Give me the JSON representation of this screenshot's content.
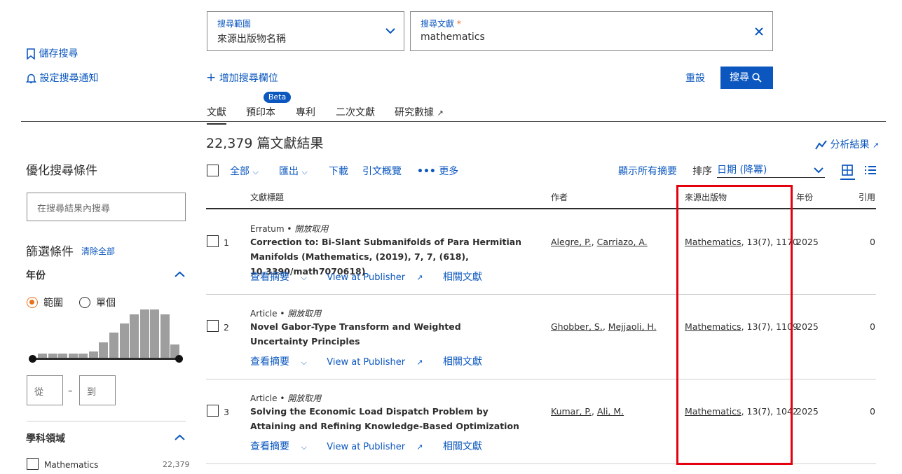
{
  "search": {
    "scope_label": "搜尋範圍",
    "scope_value": "來源出版物名稱",
    "query_label": "搜尋文獻",
    "query_required": "*",
    "query_value": "mathematics",
    "add_field": "增加搜尋欄位",
    "reset": "重設",
    "search_button": "搜尋"
  },
  "left_actions": {
    "save_search": "儲存搜尋",
    "set_alert": "設定搜尋通知"
  },
  "tabs": [
    {
      "label": "文獻",
      "active": true
    },
    {
      "label": "預印本",
      "badge": "Beta"
    },
    {
      "label": "專利"
    },
    {
      "label": "二次文獻"
    },
    {
      "label": "研究數據",
      "external": "↗"
    }
  ],
  "results": {
    "count_text": "22,379 篇文獻結果",
    "analyze": "分析結果",
    "toolbar": {
      "all": "全部",
      "export": "匯出",
      "download": "下載",
      "citation_overview": "引文概覽",
      "more": "更多",
      "show_abstracts": "顯示所有摘要",
      "sort_label": "排序",
      "sort_value": "日期 (降冪)"
    },
    "columns": {
      "title": "文獻標題",
      "authors": "作者",
      "source": "來源出版物",
      "year": "年份",
      "cited": "引用"
    },
    "rows": [
      {
        "num": "1",
        "type": "Erratum",
        "access": "開放取用",
        "title": "Correction to: Bi-Slant Submanifolds of Para Hermitian Manifolds (Mathematics, (2019), 7, 7, (618), 10.3390/math7070618)",
        "authors": [
          "Alegre, P.",
          "Carriazo, A."
        ],
        "source_name": "Mathematics",
        "source_detail": ", 13(7), 1170",
        "year": "2025",
        "cited": "0"
      },
      {
        "num": "2",
        "type": "Article",
        "access": "開放取用",
        "title": "Novel Gabor-Type Transform and Weighted Uncertainty Principles",
        "authors": [
          "Ghobber, S.",
          "Mejjaoli, H."
        ],
        "source_name": "Mathematics",
        "source_detail": ", 13(7), 1109",
        "year": "2025",
        "cited": "0"
      },
      {
        "num": "3",
        "type": "Article",
        "access": "開放取用",
        "title": "Solving the Economic Load Dispatch Problem by Attaining and Refining Knowledge-Based Optimization",
        "authors": [
          "Kumar, P.",
          "Ali, M."
        ],
        "source_name": "Mathematics",
        "source_detail": ", 13(7), 1042",
        "year": "2025",
        "cited": "0"
      }
    ],
    "row_links": {
      "abstract": "查看摘要",
      "publisher": "View at Publisher",
      "related": "相關文獻"
    }
  },
  "sidebar": {
    "refine_title": "優化搜尋條件",
    "search_within_placeholder": "在搜尋結果內搜尋",
    "filters_title": "篩選條件",
    "clear_all": "清除全部",
    "year_heading": "年份",
    "range_option": "範圍",
    "single_option": "單個",
    "from_placeholder": "從",
    "to_placeholder": "到",
    "dash": "–",
    "subject_heading": "學科領域",
    "subject_item": "Mathematics",
    "subject_count": "22,379"
  },
  "histogram": {
    "values": [
      2,
      2,
      2,
      2,
      2,
      3,
      7,
      11,
      15,
      19,
      21,
      21,
      19,
      6
    ]
  },
  "colors": {
    "accent": "#0b57bf",
    "highlight": "#e3000f",
    "radio": "#e9711c"
  }
}
